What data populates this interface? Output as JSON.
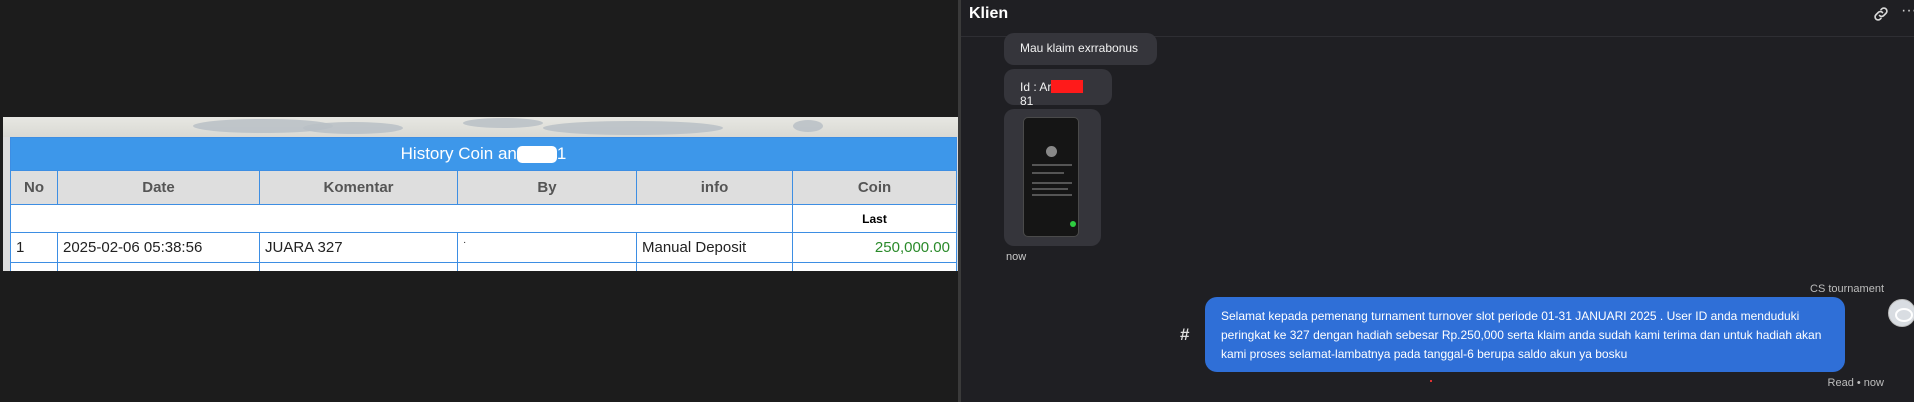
{
  "history": {
    "title_prefix": "History Coin an",
    "title_suffix": "1",
    "columns": [
      "No",
      "Date",
      "Komentar",
      "By",
      "info",
      "Coin"
    ],
    "sub_label": "Last",
    "rows": [
      {
        "no": "1",
        "date": "2025-02-06 05:38:56",
        "komentar": "JUARA 327",
        "by": "·",
        "info": "Manual Deposit",
        "coin": "250,000.00"
      }
    ]
  },
  "chat": {
    "title": "Klien",
    "msg1": "Mau klaim exrrabonus",
    "msg2_prefix": "Id : Ar",
    "msg2_suffix": "81",
    "time_in": "now",
    "sender": "CS tournament",
    "hash": "#",
    "msg_out": "Selamat kepada pemenang turnament turnover slot periode 01-31 JANUARI 2025 . User ID anda menduduki peringkat ke 327 dengan hadiah sebesar Rp.250,000 serta klaim anda sudah kami terima dan untuk hadiah akan kami proses selamat-lambatnya pada tanggal-6 berupa saldo akun ya bosku",
    "read_status": "Read • now",
    "more": "···"
  },
  "colors": {
    "table_header_blue": "#3d97ea",
    "coin_green": "#2a8a2a",
    "bubble_out_blue": "#2f6fd7",
    "redaction_red": "#ff1a1a"
  },
  "icons": {
    "link": "link-icon",
    "more": "more-icon",
    "hash": "hash-icon"
  }
}
